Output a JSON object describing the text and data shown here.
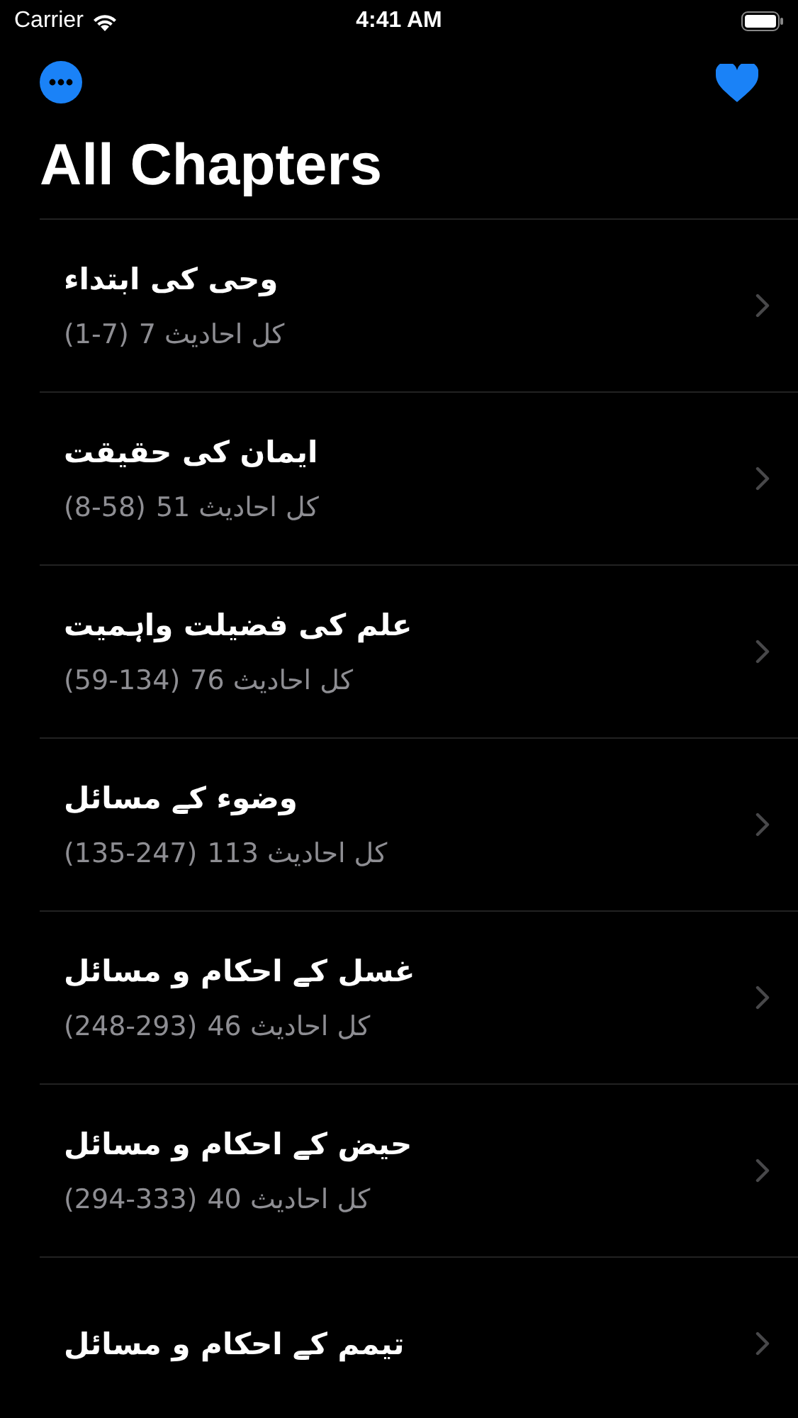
{
  "status_bar": {
    "carrier": "Carrier",
    "time": "4:41 AM"
  },
  "title": "All Chapters",
  "chapters": [
    {
      "title": "وحی کی ابتداء",
      "count": "کل احادیث 7",
      "range": "(1-7)"
    },
    {
      "title": "ایمان کی حقیقت",
      "count": "کل احادیث 51",
      "range": "(8-58)"
    },
    {
      "title": "علم کی فضیلت واہمیت",
      "count": "کل احادیث 76",
      "range": "(59-134)"
    },
    {
      "title": "وضوء کے مسائل",
      "count": "کل احادیث 113",
      "range": "(135-247)"
    },
    {
      "title": "غسل کے احکام و مسائل",
      "count": "کل احادیث 46",
      "range": "(248-293)"
    },
    {
      "title": "حیض کے احکام و مسائل",
      "count": "کل احادیث 40",
      "range": "(294-333)"
    },
    {
      "title": "تیمم کے احکام و مسائل"
    }
  ]
}
